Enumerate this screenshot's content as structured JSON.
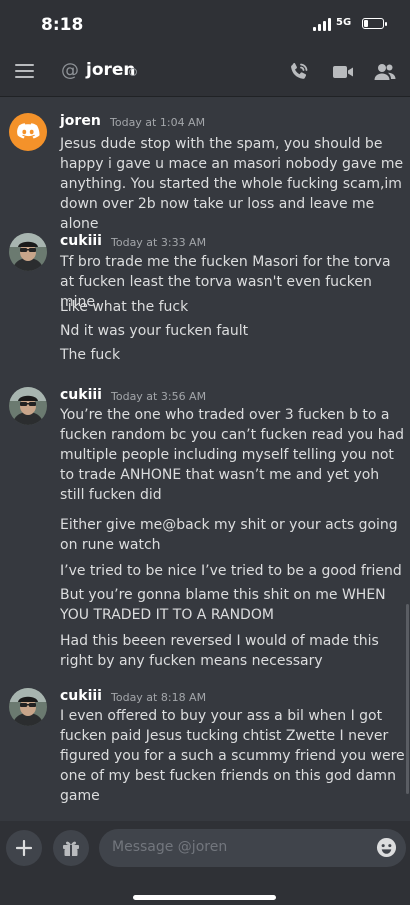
{
  "status_bar": {
    "time": "8:18",
    "network": "5G",
    "battery_level": 0.25
  },
  "header": {
    "at_symbol": "@",
    "channel_name": "joren"
  },
  "message_groups": [
    {
      "author": "joren",
      "timestamp": "Today at 1:04 AM",
      "avatar": "discord-logo-icon",
      "messages": [
        "Jesus dude stop with the spam, you should be happy i gave u mace an masori nobody gave me anything. You started the whole fucking scam,im down over 2b now take ur loss and leave me alone"
      ]
    },
    {
      "author": "cukiii",
      "timestamp": "Today at 3:33 AM",
      "avatar": "user-avatar",
      "messages": [
        "Tf bro trade me the fucken Masori for the torva at fucken least the torva wasn't even fucken mine",
        "Like what the fuck",
        "Nd it was your fucken fault",
        "The fuck"
      ]
    },
    {
      "author": "cukiii",
      "timestamp": "Today at 3:56 AM",
      "avatar": "user-avatar",
      "messages": [
        "You’re the one who traded over 3 fucken b to a fucken random bc you can’t fucken read you had multiple people including myself telling you not to trade ANHONE that wasn’t me and yet yoh still fucken did",
        "Either give me@back my shit or your acts going on rune watch",
        "I’ve tried to be nice I’ve tried to be a good friend",
        "But you’re gonna blame this shit on me WHEN YOU TRADED IT TO A RANDOM",
        "Had this beeen reversed I would of made this right by any fucken means necessary"
      ]
    },
    {
      "author": "cukiii",
      "timestamp": "Today at 8:18 AM",
      "avatar": "user-avatar",
      "messages": [
        "I even offered to buy your ass a bil when I got fucken paid Jesus tucking chtist Zwette I never figured you for a such a scummy friend you were one of my best fucken friends on this god damn game"
      ]
    }
  ],
  "composer": {
    "placeholder": "Message @joren"
  },
  "colors": {
    "background": "#36393f",
    "header": "#2f3136",
    "input": "#40444b",
    "discord_orange": "#f4922a"
  }
}
